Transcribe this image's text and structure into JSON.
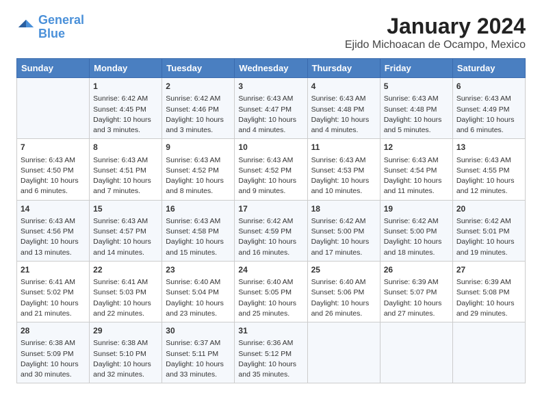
{
  "logo": {
    "line1": "General",
    "line2": "Blue"
  },
  "title": "January 2024",
  "subtitle": "Ejido Michoacan de Ocampo, Mexico",
  "headers": [
    "Sunday",
    "Monday",
    "Tuesday",
    "Wednesday",
    "Thursday",
    "Friday",
    "Saturday"
  ],
  "weeks": [
    [
      {
        "num": "",
        "info": ""
      },
      {
        "num": "1",
        "info": "Sunrise: 6:42 AM\nSunset: 4:45 PM\nDaylight: 10 hours\nand 3 minutes."
      },
      {
        "num": "2",
        "info": "Sunrise: 6:42 AM\nSunset: 4:46 PM\nDaylight: 10 hours\nand 3 minutes."
      },
      {
        "num": "3",
        "info": "Sunrise: 6:43 AM\nSunset: 4:47 PM\nDaylight: 10 hours\nand 4 minutes."
      },
      {
        "num": "4",
        "info": "Sunrise: 6:43 AM\nSunset: 4:48 PM\nDaylight: 10 hours\nand 4 minutes."
      },
      {
        "num": "5",
        "info": "Sunrise: 6:43 AM\nSunset: 4:48 PM\nDaylight: 10 hours\nand 5 minutes."
      },
      {
        "num": "6",
        "info": "Sunrise: 6:43 AM\nSunset: 4:49 PM\nDaylight: 10 hours\nand 6 minutes."
      }
    ],
    [
      {
        "num": "7",
        "info": "Sunrise: 6:43 AM\nSunset: 4:50 PM\nDaylight: 10 hours\nand 6 minutes."
      },
      {
        "num": "8",
        "info": "Sunrise: 6:43 AM\nSunset: 4:51 PM\nDaylight: 10 hours\nand 7 minutes."
      },
      {
        "num": "9",
        "info": "Sunrise: 6:43 AM\nSunset: 4:52 PM\nDaylight: 10 hours\nand 8 minutes."
      },
      {
        "num": "10",
        "info": "Sunrise: 6:43 AM\nSunset: 4:52 PM\nDaylight: 10 hours\nand 9 minutes."
      },
      {
        "num": "11",
        "info": "Sunrise: 6:43 AM\nSunset: 4:53 PM\nDaylight: 10 hours\nand 10 minutes."
      },
      {
        "num": "12",
        "info": "Sunrise: 6:43 AM\nSunset: 4:54 PM\nDaylight: 10 hours\nand 11 minutes."
      },
      {
        "num": "13",
        "info": "Sunrise: 6:43 AM\nSunset: 4:55 PM\nDaylight: 10 hours\nand 12 minutes."
      }
    ],
    [
      {
        "num": "14",
        "info": "Sunrise: 6:43 AM\nSunset: 4:56 PM\nDaylight: 10 hours\nand 13 minutes."
      },
      {
        "num": "15",
        "info": "Sunrise: 6:43 AM\nSunset: 4:57 PM\nDaylight: 10 hours\nand 14 minutes."
      },
      {
        "num": "16",
        "info": "Sunrise: 6:43 AM\nSunset: 4:58 PM\nDaylight: 10 hours\nand 15 minutes."
      },
      {
        "num": "17",
        "info": "Sunrise: 6:42 AM\nSunset: 4:59 PM\nDaylight: 10 hours\nand 16 minutes."
      },
      {
        "num": "18",
        "info": "Sunrise: 6:42 AM\nSunset: 5:00 PM\nDaylight: 10 hours\nand 17 minutes."
      },
      {
        "num": "19",
        "info": "Sunrise: 6:42 AM\nSunset: 5:00 PM\nDaylight: 10 hours\nand 18 minutes."
      },
      {
        "num": "20",
        "info": "Sunrise: 6:42 AM\nSunset: 5:01 PM\nDaylight: 10 hours\nand 19 minutes."
      }
    ],
    [
      {
        "num": "21",
        "info": "Sunrise: 6:41 AM\nSunset: 5:02 PM\nDaylight: 10 hours\nand 21 minutes."
      },
      {
        "num": "22",
        "info": "Sunrise: 6:41 AM\nSunset: 5:03 PM\nDaylight: 10 hours\nand 22 minutes."
      },
      {
        "num": "23",
        "info": "Sunrise: 6:40 AM\nSunset: 5:04 PM\nDaylight: 10 hours\nand 23 minutes."
      },
      {
        "num": "24",
        "info": "Sunrise: 6:40 AM\nSunset: 5:05 PM\nDaylight: 10 hours\nand 25 minutes."
      },
      {
        "num": "25",
        "info": "Sunrise: 6:40 AM\nSunset: 5:06 PM\nDaylight: 10 hours\nand 26 minutes."
      },
      {
        "num": "26",
        "info": "Sunrise: 6:39 AM\nSunset: 5:07 PM\nDaylight: 10 hours\nand 27 minutes."
      },
      {
        "num": "27",
        "info": "Sunrise: 6:39 AM\nSunset: 5:08 PM\nDaylight: 10 hours\nand 29 minutes."
      }
    ],
    [
      {
        "num": "28",
        "info": "Sunrise: 6:38 AM\nSunset: 5:09 PM\nDaylight: 10 hours\nand 30 minutes."
      },
      {
        "num": "29",
        "info": "Sunrise: 6:38 AM\nSunset: 5:10 PM\nDaylight: 10 hours\nand 32 minutes."
      },
      {
        "num": "30",
        "info": "Sunrise: 6:37 AM\nSunset: 5:11 PM\nDaylight: 10 hours\nand 33 minutes."
      },
      {
        "num": "31",
        "info": "Sunrise: 6:36 AM\nSunset: 5:12 PM\nDaylight: 10 hours\nand 35 minutes."
      },
      {
        "num": "",
        "info": ""
      },
      {
        "num": "",
        "info": ""
      },
      {
        "num": "",
        "info": ""
      }
    ]
  ]
}
